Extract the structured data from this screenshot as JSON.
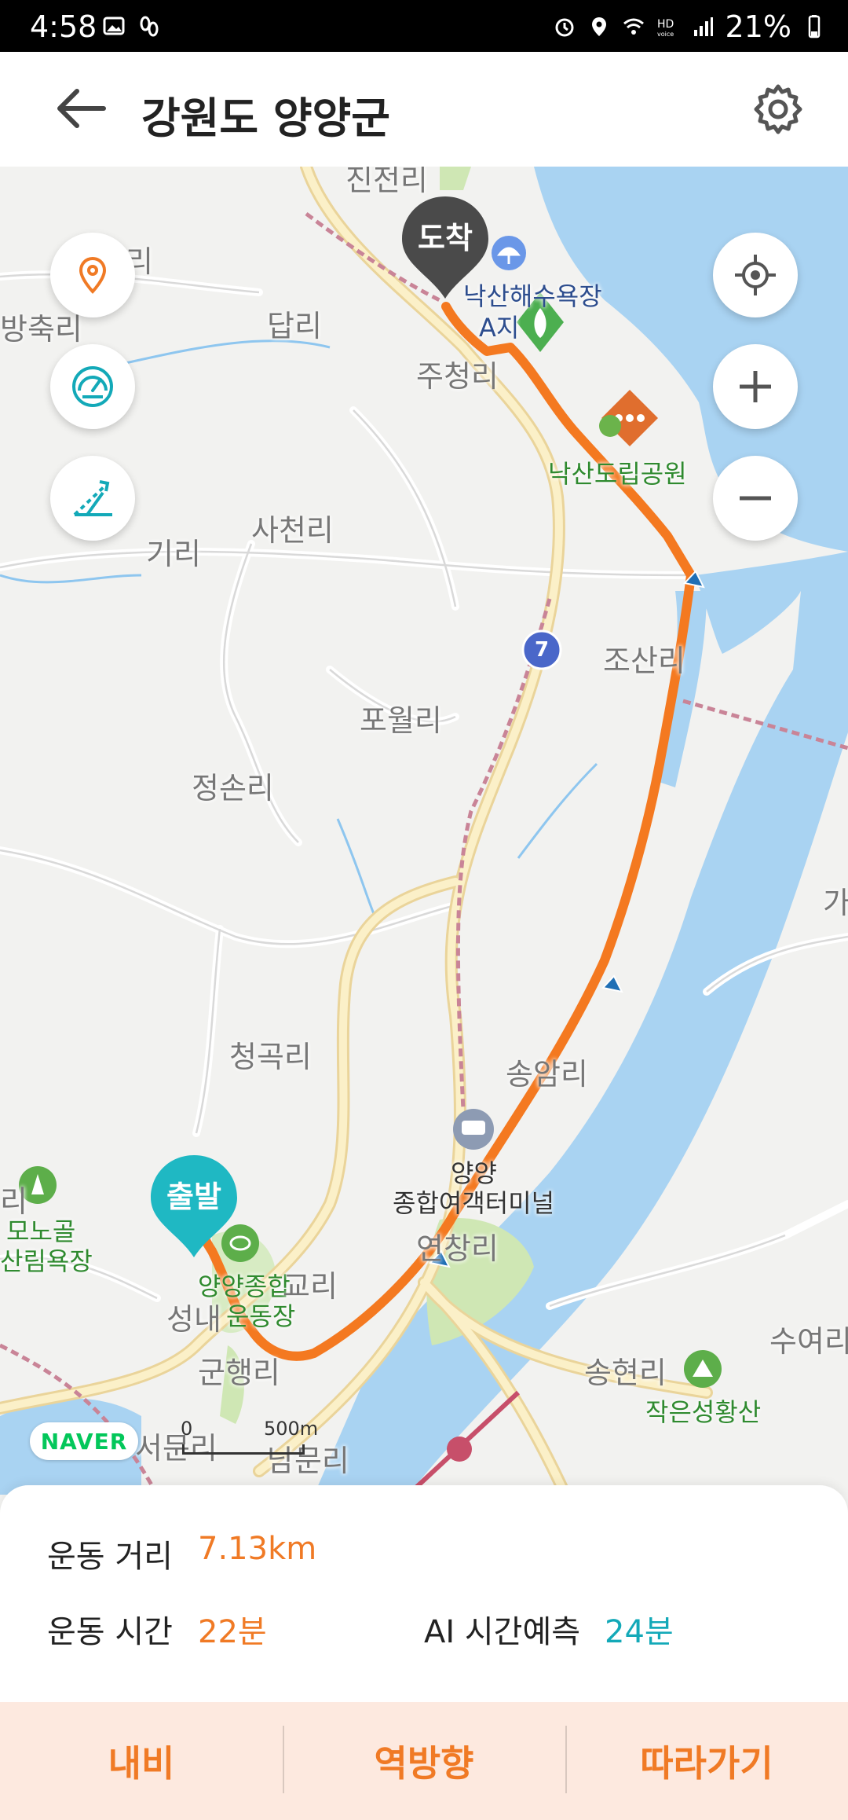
{
  "status_bar": {
    "time": "4:58",
    "battery": "21%",
    "left_icons": [
      "image-icon",
      "step-tracker-icon"
    ],
    "right_icons": [
      "alarm-icon",
      "location-icon",
      "wifi-icon",
      "hd-voice-icon",
      "signal-icon",
      "battery-icon"
    ]
  },
  "header": {
    "title": "강원도 양양군",
    "back_icon": "arrow-left-icon",
    "settings_icon": "gear-icon"
  },
  "map": {
    "labels": {
      "jinjeonri": "진전리",
      "ri_top_left": "리",
      "bangchukri": "방축리",
      "dapri": "답리",
      "juchungri": "주청리",
      "beach_line1": "낙산해수욕장",
      "beach_line2": "A지",
      "naksan_park": "낙산도립공원",
      "sacheonri": "사천리",
      "giri": "기리",
      "josanri": "조산리",
      "powolri": "포월리",
      "jeongsonri": "정손리",
      "ga": "가",
      "cheonggokri": "청곡리",
      "songamri": "송암리",
      "terminal_line1": "양양",
      "terminal_line2": "종합여객터미널",
      "yeonchangri": "연창리",
      "ri_left": "리",
      "monogol_line1": "모노골",
      "monogol_line2": "산림욕장",
      "stadium_line1": "양양종합",
      "stadium_line2": "운동장",
      "gyori": "교리",
      "seongnae": "성내",
      "gunhaengri": "군행리",
      "seomunri": "서문리",
      "nammunri": "남문리",
      "songhyeonri": "송현리",
      "jageun_mountain": "작은성황산",
      "suyeori": "수여리"
    },
    "road_number": "7",
    "start_pin": "출발",
    "end_pin": "도착",
    "naver_logo": "NAVER",
    "scale_zero": "0",
    "scale_500": "500m",
    "route_color": "#f47920",
    "water_color": "#a9d3f2"
  },
  "map_controls": {
    "left": [
      "location-pin-icon",
      "speedometer-icon",
      "slope-icon"
    ],
    "right": [
      "my-location-icon",
      "zoom-in-icon",
      "zoom-out-icon"
    ]
  },
  "stats": {
    "distance_label": "운동 거리",
    "distance_value": "7.13km",
    "time_label": "운동 시간",
    "time_value": "22분",
    "ai_label": "AI 시간예측",
    "ai_value": "24분"
  },
  "actions": {
    "navigate": "내비",
    "reverse": "역방향",
    "follow": "따라가기"
  }
}
